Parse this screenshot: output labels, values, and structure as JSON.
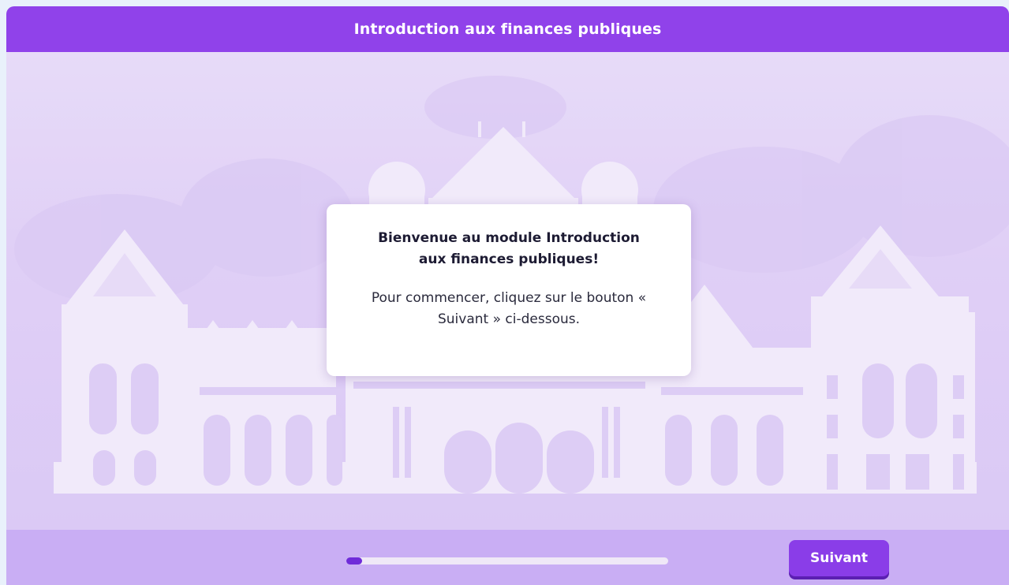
{
  "header": {
    "title": "Introduction aux finances publiques"
  },
  "dialog": {
    "title": "Bienvenue au module Introduction aux finances publiques!",
    "body": "Pour commencer, cliquez sur le bouton « Suivant » ci-dessous."
  },
  "footer": {
    "progress_fraction": 0.05,
    "next_label": "Suivant"
  },
  "colors": {
    "header": "#9042ea",
    "stage": "#e6d9f7",
    "footer": "#c9aef4",
    "button": "#8a3de8",
    "progress_fill": "#6f2bd9",
    "progress_track": "#efe8f7",
    "silhouette": "#f4eefb"
  },
  "icons": {
    "background": "parliament-building-silhouette"
  }
}
